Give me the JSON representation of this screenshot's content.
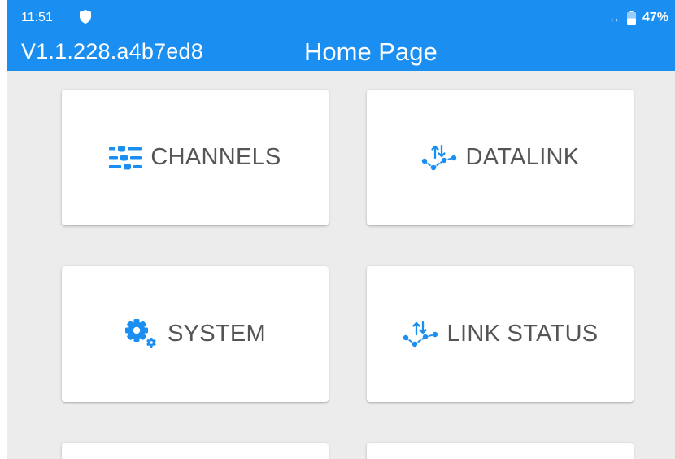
{
  "status_bar": {
    "time": "11:51",
    "shield_icon": "shield-icon",
    "link_icon": "↔",
    "battery_icon": "battery-icon",
    "battery": "47%"
  },
  "header": {
    "version": "V1.1.228.a4b7ed8",
    "title": "Home Page",
    "background_color": "#1b8ff1"
  },
  "tiles": [
    {
      "label": "CHANNELS",
      "icon": "sliders-icon"
    },
    {
      "label": "DATALINK",
      "icon": "datalink-icon"
    },
    {
      "label": "SYSTEM",
      "icon": "gear-icon"
    },
    {
      "label": "LINK STATUS",
      "icon": "datalink-icon"
    }
  ],
  "accent_color": "#1b8ff1"
}
